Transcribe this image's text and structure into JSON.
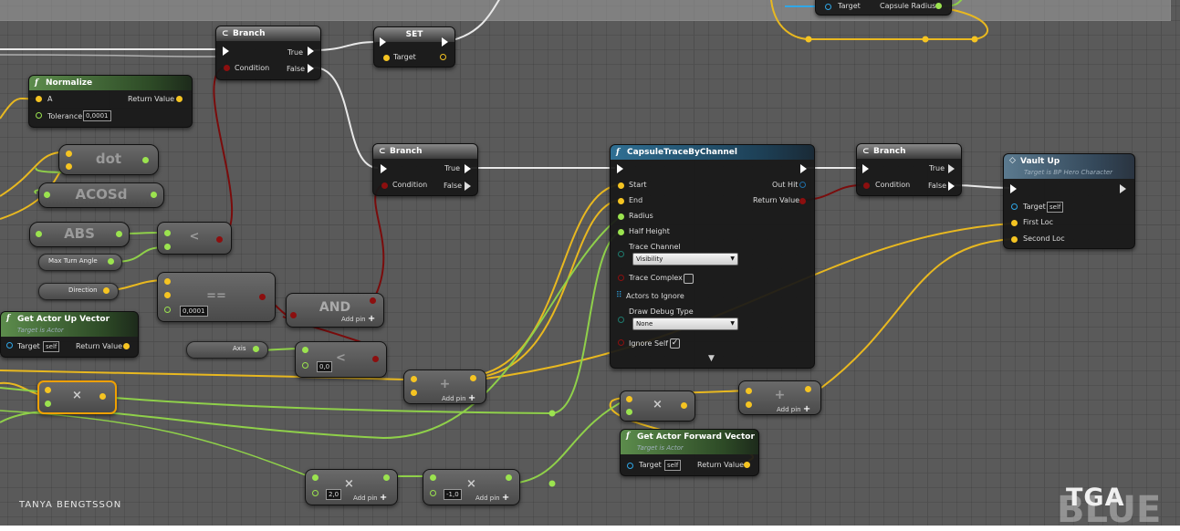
{
  "nodes": {
    "branch1": {
      "title": "Branch",
      "true": "True",
      "false": "False",
      "condition": "Condition"
    },
    "set": {
      "title": "SET",
      "target": "Target"
    },
    "top_partial": {
      "target": "Target",
      "capsule_radius": "Capsule Radius"
    },
    "normalize": {
      "title": "Normalize",
      "a": "A",
      "return": "Return Value",
      "tolerance": "Tolerance",
      "tolerance_value": "0,0001"
    },
    "dot": {
      "label": "dot"
    },
    "acosd": {
      "label": "ACOSd"
    },
    "abs": {
      "label": "ABS"
    },
    "less1": {
      "label": "<"
    },
    "max_turn": {
      "label": "Max Turn Angle"
    },
    "direction": {
      "label": "Direction"
    },
    "equal": {
      "label": "==",
      "value": "0,0001"
    },
    "and": {
      "label": "AND",
      "add_pin": "Add pin"
    },
    "actor_up": {
      "title": "Get Actor Up Vector",
      "subtitle": "Target is Actor",
      "target": "Target",
      "self": "self",
      "return": "Return Value"
    },
    "axis": {
      "label": "Axis"
    },
    "less2": {
      "label": "<",
      "value": "0,0"
    },
    "mult1": {
      "label": "×"
    },
    "add1": {
      "label": "+",
      "add_pin": "Add pin"
    },
    "branch2": {
      "title": "Branch",
      "true": "True",
      "false": "False",
      "condition": "Condition"
    },
    "capsule": {
      "title": "CapsuleTraceByChannel",
      "start": "Start",
      "end": "End",
      "radius": "Radius",
      "half_height": "Half Height",
      "trace_channel": "Trace Channel",
      "trace_value": "Visibility",
      "trace_complex": "Trace Complex",
      "actors_ignore": "Actors to Ignore",
      "draw_debug": "Draw Debug Type",
      "draw_value": "None",
      "ignore_self": "Ignore Self",
      "out_hit": "Out Hit",
      "return": "Return Value"
    },
    "branch3": {
      "title": "Branch",
      "true": "True",
      "false": "False",
      "condition": "Condition"
    },
    "vault": {
      "title": "Vault Up",
      "subtitle": "Target is BP Hero Character",
      "target": "Target",
      "self": "self",
      "first": "First Loc",
      "second": "Second Loc"
    },
    "mult2": {
      "label": "×"
    },
    "add2": {
      "label": "+",
      "add_pin": "Add pin"
    },
    "fwd": {
      "title": "Get Actor Forward Vector",
      "subtitle": "Target is Actor",
      "target": "Target",
      "self": "self",
      "return": "Return Value"
    },
    "mult3": {
      "label": "×",
      "value": "2,0",
      "add_pin": "Add pin"
    },
    "mult4": {
      "label": "×",
      "value": "-1,0",
      "add_pin": "Add pin"
    }
  },
  "credit": "TANYA BENGTSSON",
  "logo": "TGA",
  "logo_ghost": "BLUE",
  "colors": {
    "exec": "#ffffff",
    "bool": "#8c0f0f",
    "float": "#9be34f",
    "vector": "#f5c422",
    "object": "#2fa7e8",
    "struct": "#1f6fa8",
    "byte": "#1f7a6e",
    "selected": "#f0a000"
  }
}
